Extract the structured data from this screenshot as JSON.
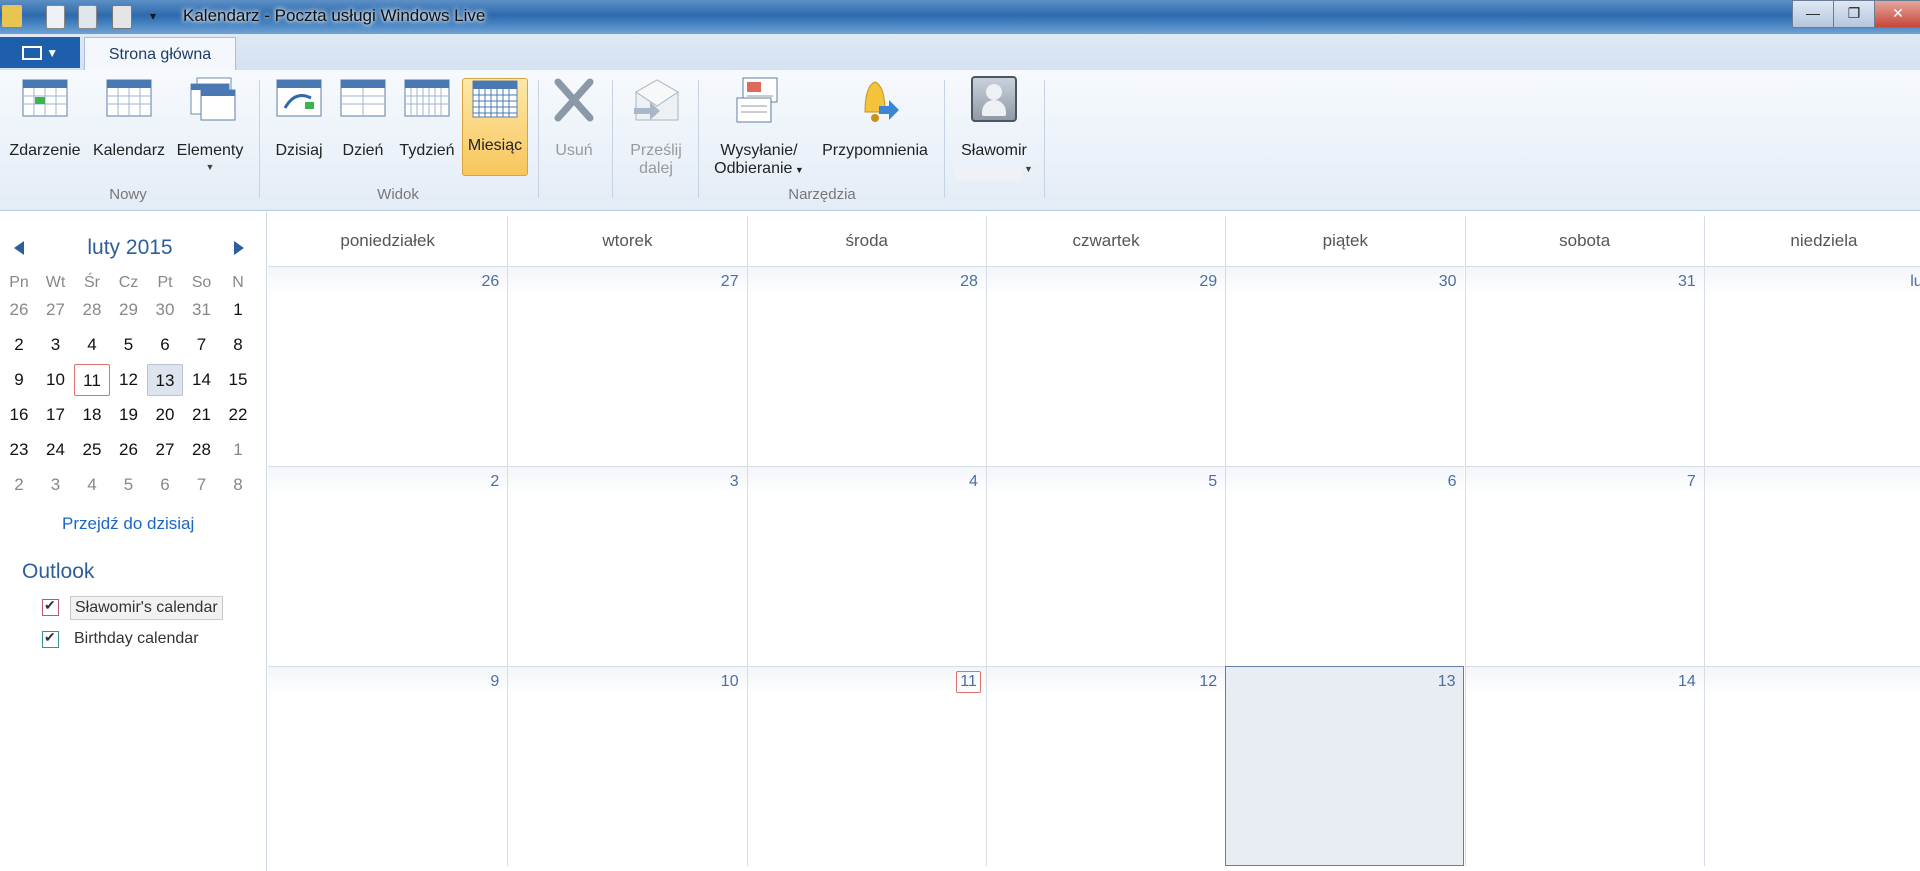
{
  "window": {
    "title": "Kalendarz - Poczta usługi Windows Live",
    "minimize": "▭",
    "restore": "❐",
    "close": "✕"
  },
  "tabs": {
    "home": "Strona główna"
  },
  "ribbon": {
    "groups": {
      "new": "Nowy",
      "view": "Widok",
      "tools": "Narzędzia"
    },
    "buttons": {
      "event": "Zdarzenie",
      "calendar": "Kalendarz",
      "items": "Elementy",
      "today": "Dzisiaj",
      "day": "Dzień",
      "week": "Tydzień",
      "month": "Miesiąc",
      "delete": "Usuń",
      "forward_line1": "Prześlij",
      "forward_line2": "dalej",
      "sendrecv_line1": "Wysyłanie/",
      "sendrecv_line2": "Odbieranie",
      "reminders": "Przypomnienia",
      "account": "Sławomir"
    }
  },
  "mini_calendar": {
    "month_label": "luty 2015",
    "weekdays": [
      "Pn",
      "Wt",
      "Śr",
      "Cz",
      "Pt",
      "So",
      "N"
    ],
    "weeks": [
      [
        "26",
        "27",
        "28",
        "29",
        "30",
        "31",
        "1"
      ],
      [
        "2",
        "3",
        "4",
        "5",
        "6",
        "7",
        "8"
      ],
      [
        "9",
        "10",
        "11",
        "12",
        "13",
        "14",
        "15"
      ],
      [
        "16",
        "17",
        "18",
        "19",
        "20",
        "21",
        "22"
      ],
      [
        "23",
        "24",
        "25",
        "26",
        "27",
        "28",
        "1"
      ],
      [
        "2",
        "3",
        "4",
        "5",
        "6",
        "7",
        "8"
      ]
    ],
    "today": "11",
    "selected": "13",
    "go_to_today": "Przejdź do dzisiaj"
  },
  "calendars": {
    "group": "Outlook",
    "items": [
      {
        "name": "Sławomir's calendar",
        "checked": true,
        "color": "#c0508a"
      },
      {
        "name": "Birthday calendar",
        "checked": true,
        "color": "#3a8f8f"
      }
    ]
  },
  "month_view": {
    "day_names": [
      "poniedziałek",
      "wtorek",
      "środa",
      "czwartek",
      "piątek",
      "sobota",
      "niedziela"
    ],
    "weeks": [
      [
        "26",
        "27",
        "28",
        "29",
        "30",
        "31",
        "luty"
      ],
      [
        "2",
        "3",
        "4",
        "5",
        "6",
        "7",
        ""
      ],
      [
        "9",
        "10",
        "11",
        "12",
        "13",
        "14",
        ""
      ]
    ],
    "today": "11",
    "selected": "13"
  },
  "colors": {
    "accent": "#2d5e9a",
    "active_button": "#f8c65c",
    "today_border": "#e3716b"
  }
}
